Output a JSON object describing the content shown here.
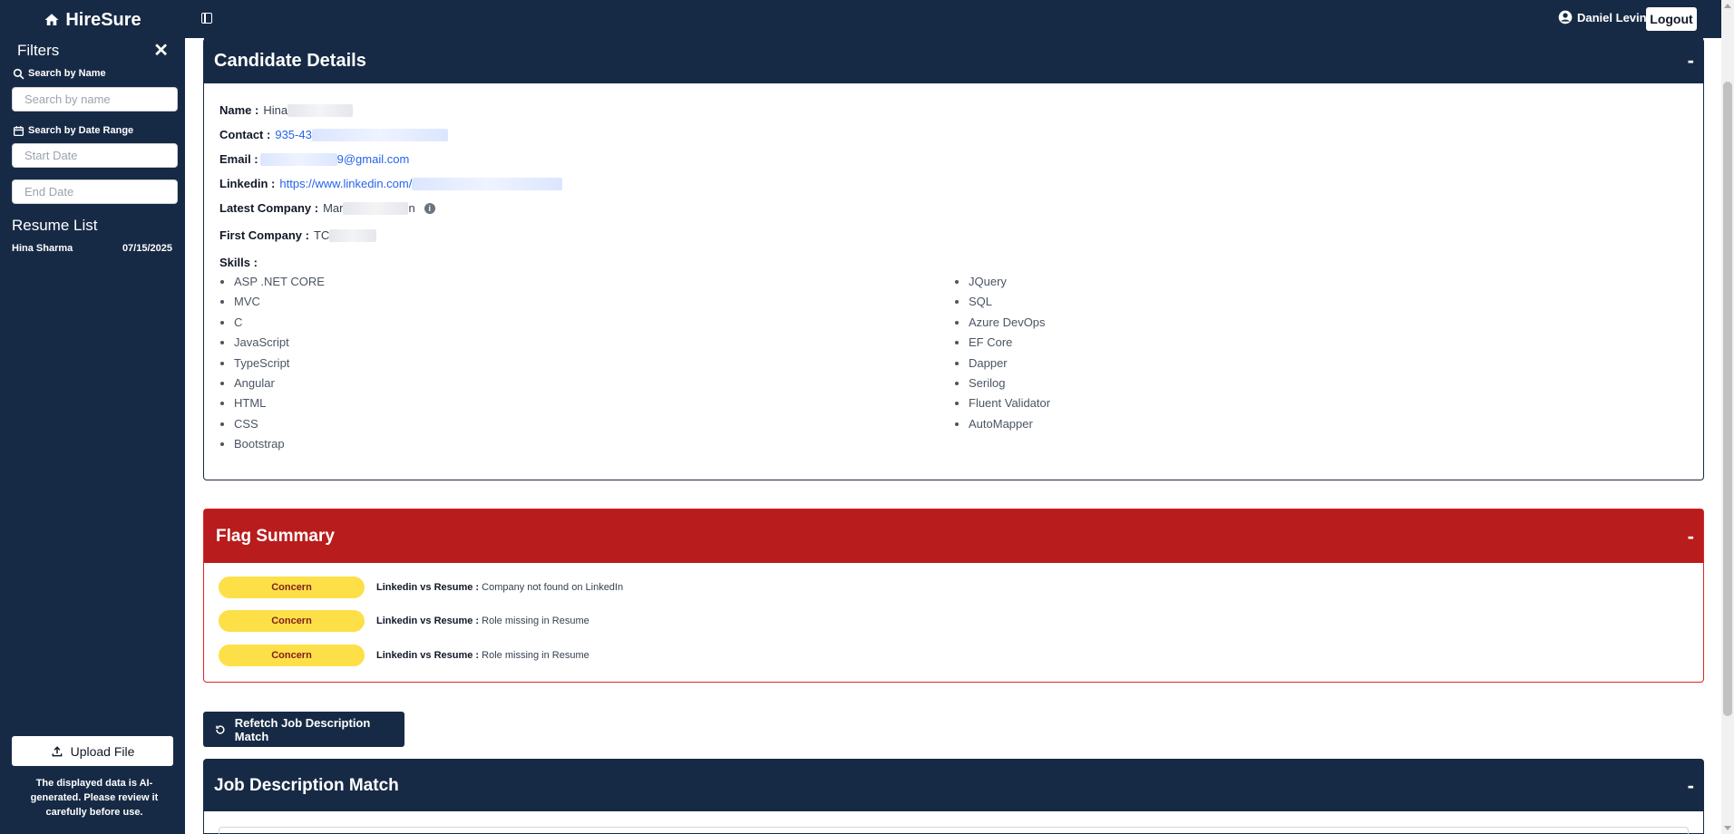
{
  "app": {
    "name": "HireSure"
  },
  "header": {
    "user_name": "Daniel Levin",
    "logout_label": "Logout"
  },
  "sidebar": {
    "filters_title": "Filters",
    "close_symbol": "✕",
    "search_name_label": "Search by Name",
    "search_name_placeholder": "Search by name",
    "date_range_label": "Search by Date Range",
    "start_date_placeholder": "Start Date",
    "end_date_placeholder": "End Date",
    "resume_list_title": "Resume List",
    "resumes": [
      {
        "name": "Hina Sharma",
        "date": "07/15/2025"
      }
    ],
    "upload_label": "Upload File",
    "disclaimer": "The displayed data is AI-generated. Please review it carefully before use."
  },
  "candidate": {
    "title": "Candidate Details",
    "collapse_symbol": "-",
    "name_label": "Name :",
    "name_value": "Hina",
    "contact_label": "Contact :",
    "contact_value": "935-43",
    "email_label": "Email :",
    "email_value": "9@gmail.com",
    "linkedin_label": "Linkedin :",
    "linkedin_value": "https://www.linkedin.com/",
    "latest_company_label": "Latest Company :",
    "latest_company_value": "Mar",
    "latest_company_suffix": "n",
    "info_symbol": "i",
    "first_company_label": "First Company :",
    "first_company_value": "TC",
    "skills_label": "Skills :",
    "skills_left": [
      "ASP .NET CORE",
      "MVC",
      "C",
      "JavaScript",
      "TypeScript",
      "Angular",
      "HTML",
      "CSS",
      "Bootstrap"
    ],
    "skills_right": [
      "JQuery",
      "SQL",
      "Azure DevOps",
      "EF Core",
      "Dapper",
      "Serilog",
      "Fluent Validator",
      "AutoMapper"
    ]
  },
  "flag_summary": {
    "title": "Flag Summary",
    "collapse_symbol": "-",
    "flags": [
      {
        "badge": "Concern",
        "source": "Linkedin vs Resume :",
        "text": "Company not found on LinkedIn"
      },
      {
        "badge": "Concern",
        "source": "Linkedin vs Resume :",
        "text": "Role missing in Resume"
      },
      {
        "badge": "Concern",
        "source": "Linkedin vs Resume :",
        "text": "Role missing in Resume"
      }
    ]
  },
  "refetch_label": "Refetch Job Description Match",
  "job_match": {
    "title": "Job Description Match",
    "collapse_symbol": "-"
  },
  "colors": {
    "navy": "#172a45",
    "flag_red": "#b91c1c",
    "concern_yellow": "#fde047",
    "link_blue": "#2563eb"
  }
}
